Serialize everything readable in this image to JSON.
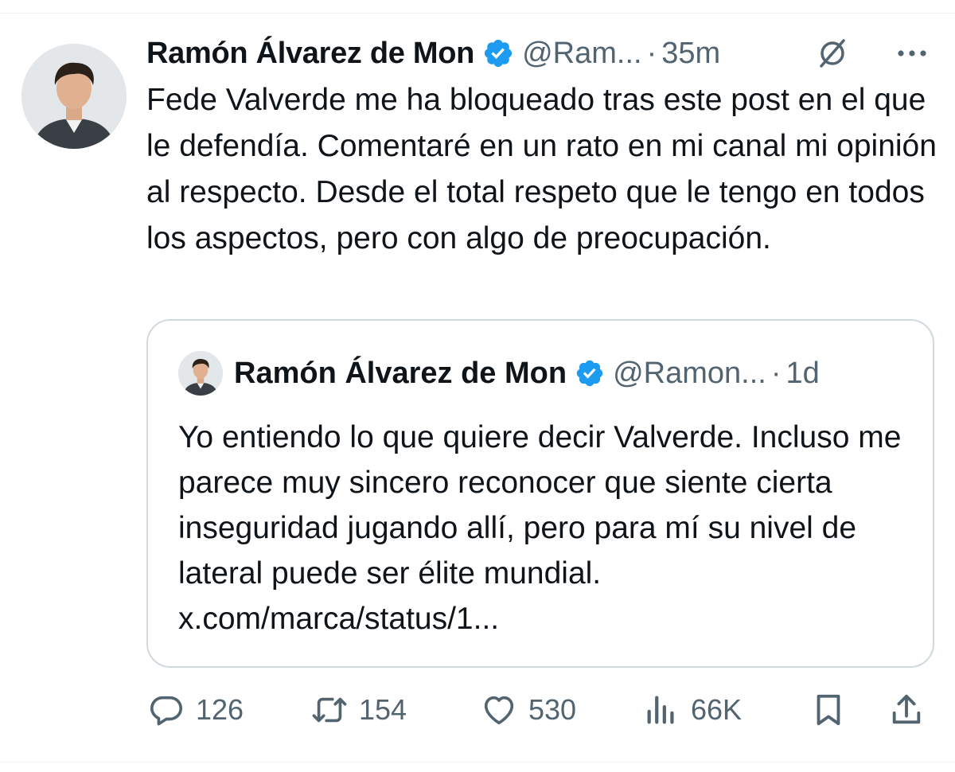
{
  "tweet": {
    "author_name": "Ramón Álvarez de Mon",
    "handle": "@Ram...",
    "separator": "·",
    "time": "35m",
    "text": "Fede Valverde me ha bloqueado tras este post en el que le defendía. Comentaré en un rato en mi canal mi opinión al respecto. Desde el total respeto que le tengo en todos los aspectos, pero con algo de preocupación.",
    "verified_icon": "verified-badge-icon",
    "grok_icon": "grok-icon",
    "more_icon": "more-options-icon"
  },
  "quote": {
    "author_name": "Ramón Álvarez de Mon",
    "handle": "@Ramon...",
    "separator": "·",
    "time": "1d",
    "text": "Yo entiendo lo que quiere decir Valverde. Incluso me parece muy sincero reconocer que siente cierta inseguridad jugando allí, pero para mí su nivel de lateral puede ser élite mundial. x.com/marca/status/1..."
  },
  "actions": {
    "replies": "126",
    "reposts": "154",
    "likes": "530",
    "views": "66K"
  },
  "colors": {
    "text": "#0f1419",
    "secondary": "#536471",
    "verified": "#1d9bf0",
    "border": "#cfd9de"
  }
}
